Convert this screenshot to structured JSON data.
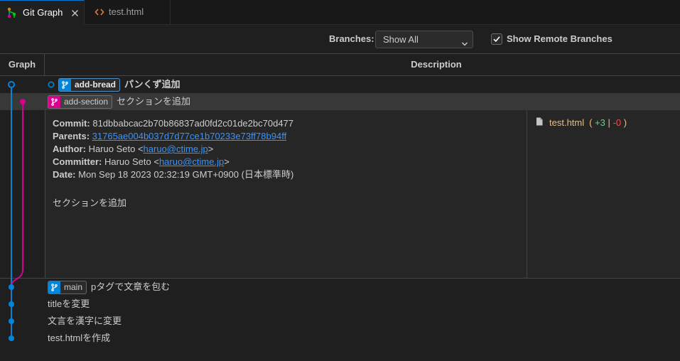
{
  "tabs": [
    {
      "label": "Git Graph",
      "icon": "git-graph-icon",
      "active": true
    },
    {
      "label": "test.html",
      "icon": "html-file-icon"
    }
  ],
  "controls": {
    "branches_label": "Branches:",
    "branches_value": "Show All",
    "show_remote_label": "Show Remote Branches",
    "show_remote_checked": true
  },
  "table": {
    "graph_header": "Graph",
    "description_header": "Description"
  },
  "commits": [
    {
      "branch": "add-bread",
      "message": "パンくず追加",
      "head": true,
      "color": "#0085d9"
    },
    {
      "branch": "add-section",
      "message": "セクションを追加",
      "selected": true,
      "color": "#d9008f"
    },
    {
      "branch": "main",
      "message": "pタグで文章を包む",
      "color": "#0085d9"
    },
    {
      "message": "titleを変更"
    },
    {
      "message": "文言を漢字に変更"
    },
    {
      "message": "test.htmlを作成"
    }
  ],
  "details": {
    "commit_label": "Commit:",
    "commit": "81dbbabcac2b70b86837ad0fd2c01de2bc70d477",
    "parents_label": "Parents:",
    "parents": "31765ae004b037d7d77ce1b70233e73ff78b94ff",
    "author_label": "Author:",
    "author_name": "Haruo Seto",
    "author_email": "haruo@ctime.jp",
    "committer_label": "Committer:",
    "committer_name": "Haruo Seto",
    "committer_email": "haruo@ctime.jp",
    "email_open": "<",
    "email_close": ">",
    "date_label": "Date:",
    "date": "Mon Sep 18 2023 02:32:19 GMT+0900 (日本標準時)",
    "message": "セクションを追加",
    "files": [
      {
        "name": "test.html",
        "open": "(",
        "additions": "+3",
        "sep": "|",
        "deletions": "-0",
        "close": ")"
      }
    ]
  },
  "colors": {
    "graph_blue": "#0085d9",
    "graph_magenta": "#d9008f",
    "link": "#3794ff",
    "modified_file": "#e2c08d",
    "additions": "#73c991",
    "deletions": "#f14c4c",
    "accent": "#0078d4"
  }
}
